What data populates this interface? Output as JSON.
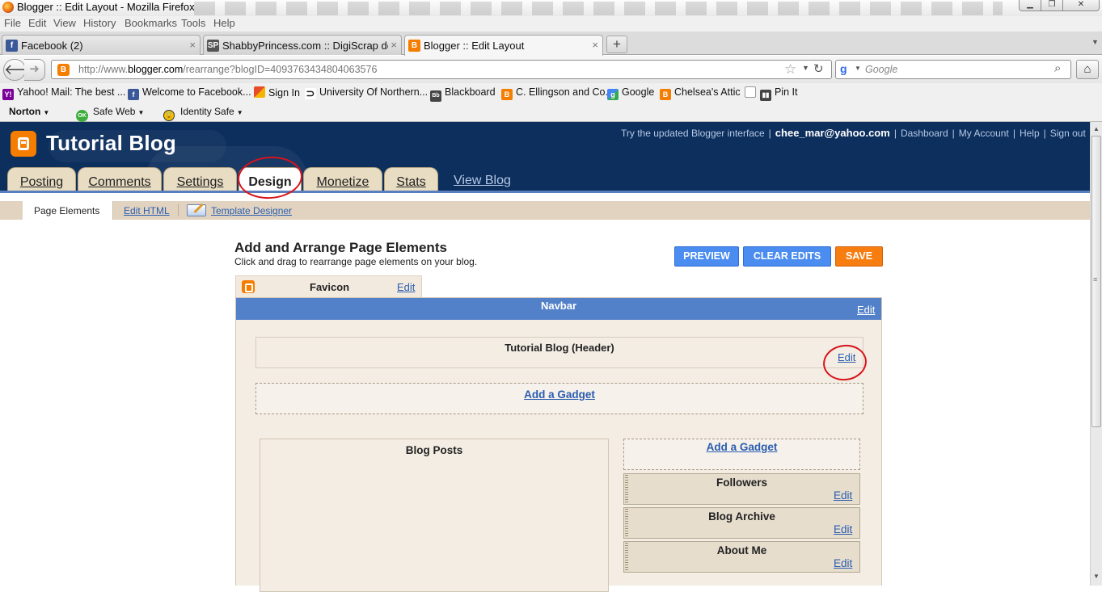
{
  "window": {
    "title": "Blogger :: Edit Layout - Mozilla Firefox"
  },
  "menu": [
    "File",
    "Edit",
    "View",
    "History",
    "Bookmarks",
    "Tools",
    "Help"
  ],
  "tabs": [
    {
      "label": "Facebook (2)",
      "icon": "facebook-icon",
      "color": "#3b5998",
      "active": false
    },
    {
      "label": "ShabbyPrincess.com :: DigiScrap dow...",
      "icon": "shabbyprincess-icon",
      "color": "#555555",
      "active": false
    },
    {
      "label": "Blogger :: Edit Layout",
      "icon": "blogger-icon",
      "color": "#f57d00",
      "active": true
    }
  ],
  "url": {
    "prefix": "http://www.",
    "domain": "blogger.com",
    "path": "/rearrange?blogID=4093763434804063576"
  },
  "search": {
    "placeholder": "Google"
  },
  "bookmarks": [
    {
      "label": "Yahoo! Mail: The best ...",
      "icon": "yahoo-icon",
      "color": "#7b0099"
    },
    {
      "label": "Welcome to Facebook...",
      "icon": "facebook-icon",
      "color": "#3b5998"
    },
    {
      "label": "Sign In",
      "icon": "windows-icon",
      "color": "#e0a020"
    },
    {
      "label": "University Of Northern...",
      "icon": "uni-icon",
      "color": "#222222"
    },
    {
      "label": "Blackboard",
      "icon": "blackboard-icon",
      "color": "#444444"
    },
    {
      "label": "C. Ellingson and Co.",
      "icon": "blogger-icon",
      "color": "#f57d00"
    },
    {
      "label": "Google",
      "icon": "google-icon",
      "color": "#3369e8"
    },
    {
      "label": "Chelsea's Attic",
      "icon": "blogger-icon",
      "color": "#f57d00"
    },
    {
      "label": "",
      "icon": "page-icon",
      "color": "#ffffff"
    },
    {
      "label": "Pin It",
      "icon": "pin-icon",
      "color": "#444444"
    }
  ],
  "norton": {
    "brand": "Norton",
    "safe_web": "Safe Web",
    "ok_badge": "OK",
    "identity_safe": "Identity Safe"
  },
  "blogger": {
    "blog_title": "Tutorial Blog",
    "toplinks": {
      "try_new": "Try the updated Blogger interface",
      "email": "chee_mar@yahoo.com",
      "dashboard": "Dashboard",
      "account": "My Account",
      "help": "Help",
      "signout": "Sign out"
    },
    "tabs": [
      "Posting",
      "Comments",
      "Settings",
      "Design",
      "Monetize",
      "Stats"
    ],
    "active_tab": "Design",
    "view_blog": "View Blog",
    "subnav": {
      "page_elements": "Page Elements",
      "edit_html": "Edit HTML",
      "template_designer": "Template Designer"
    },
    "section_title": "Add and Arrange Page Elements",
    "section_sub": "Click and drag to rearrange page elements on your blog.",
    "buttons": {
      "preview": "PREVIEW",
      "clear": "CLEAR EDITS",
      "save": "SAVE"
    },
    "favicon": {
      "label": "Favicon",
      "edit": "Edit"
    },
    "navbar": {
      "label": "Navbar",
      "edit": "Edit"
    },
    "header": {
      "label": "Tutorial Blog (Header)",
      "edit": "Edit"
    },
    "add_gadget": "Add a Gadget",
    "blog_posts": "Blog Posts",
    "sidebar_gadgets": [
      {
        "label": "Followers",
        "edit": "Edit"
      },
      {
        "label": "Blog Archive",
        "edit": "Edit"
      },
      {
        "label": "About Me",
        "edit": "Edit"
      }
    ]
  },
  "colors": {
    "blogger_header": "#0d2f5e",
    "navbar_gadget": "#5381c9",
    "save": "#f77d10",
    "preview": "#4a8cf0",
    "annotation": "#d8141b"
  }
}
